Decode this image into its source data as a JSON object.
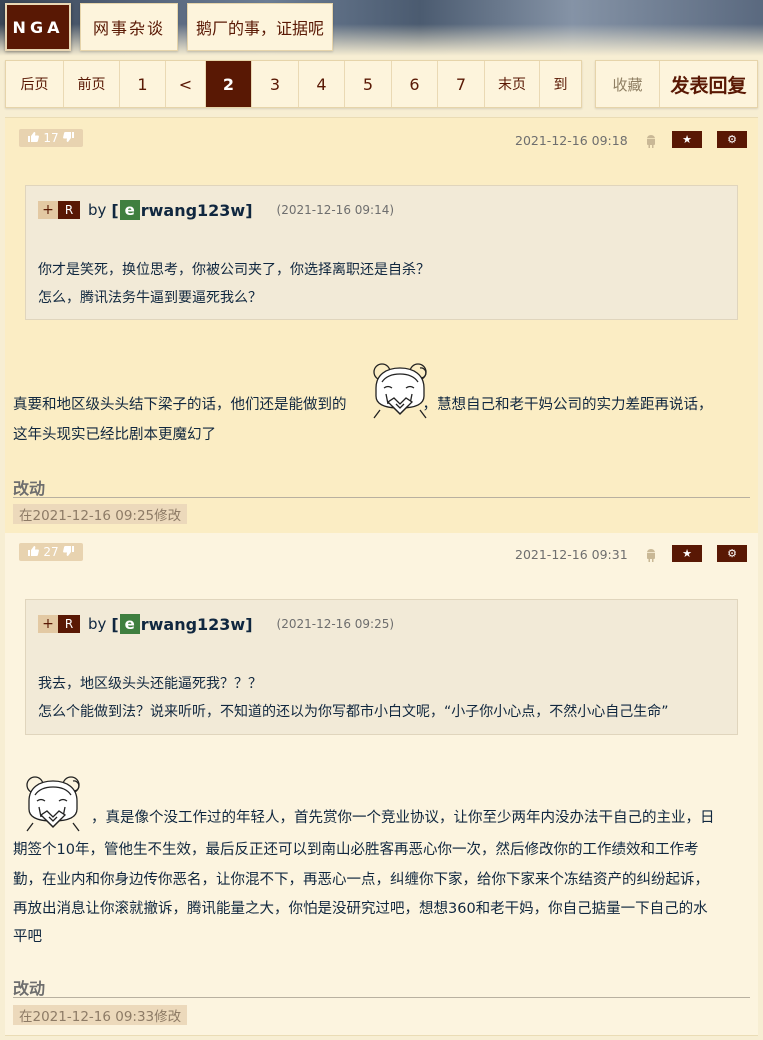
{
  "header": {
    "logo": "NGA",
    "breadcrumbs": [
      "网事杂谈",
      "鹅厂的事，证据呢"
    ]
  },
  "pager": {
    "items": [
      "后页",
      "前页",
      "1",
      "<",
      "2",
      "3",
      "4",
      "5",
      "6",
      "7",
      "末页",
      "到"
    ],
    "current": "2"
  },
  "actions": {
    "favorite": "收藏",
    "reply": "发表回复"
  },
  "posts": [
    {
      "likes": "17",
      "timestamp": "2021-12-16 09:18",
      "quote": {
        "plus": "+",
        "r": "R",
        "by": "by",
        "bracket": "[",
        "user_initial": "e",
        "user_rest": "rwang123w]",
        "time": "(2021-12-16 09:14)",
        "lines": [
          "你才是笑死，换位思考，你被公司夹了，你选择离职还是自杀？",
          "怎么，腾讯法务牛逼到要逼死我么？"
        ]
      },
      "body_before": "真要和地区级头头结下梁子的话，他们还是能做到的",
      "body_after": "，慧想自己和老干妈公司的实力差距再说话，",
      "body_line2": "这年头现实已经比剧本更魔幻了",
      "edit_title": "改动",
      "edit_note": "在2021-12-16 09:25修改"
    },
    {
      "likes": "27",
      "timestamp": "2021-12-16 09:31",
      "quote": {
        "plus": "+",
        "r": "R",
        "by": "by",
        "bracket": "[",
        "user_initial": "e",
        "user_rest": "rwang123w]",
        "time": "(2021-12-16 09:25)",
        "lines": [
          "我去，地区级头头还能逼死我？？？",
          "怎么个能做到法？说来听听，不知道的还以为你写都市小白文呢，“小子你小心点，不然小心自己生命”"
        ]
      },
      "body_lines": [
        "，真是像个没工作过的年轻人，首先赏你一个竞业协议，让你至少两年内没办法干自己的主业，日",
        "期签个10年，管他生不生效，最后反正还可以到南山必胜客再恶心你一次，然后修改你的工作绩效和工作考",
        "勤，在业内和你身边传你恶名，让你混不下，再恶心一点，纠缠你下家，给你下家来个冻结资产的纠纷起诉，",
        "再放出消息让你滚就撤诉，腾讯能量之大，你怕是没研究过吧，想想360和老干妈，你自己掂量一下自己的水",
        "平吧"
      ],
      "edit_title": "改动",
      "edit_note": "在2021-12-16 09:33修改"
    }
  ],
  "icons": {
    "thumb_up": "thumb-up-icon",
    "thumb_down": "thumb-down-icon",
    "android": "android-icon",
    "star": "star-icon",
    "gear": "gear-icon"
  },
  "colors": {
    "brand": "#591804",
    "post_bg_1": "#fbedc4",
    "post_bg_2": "#fcf4df",
    "user_initial_bg": "#3f7f3f"
  }
}
